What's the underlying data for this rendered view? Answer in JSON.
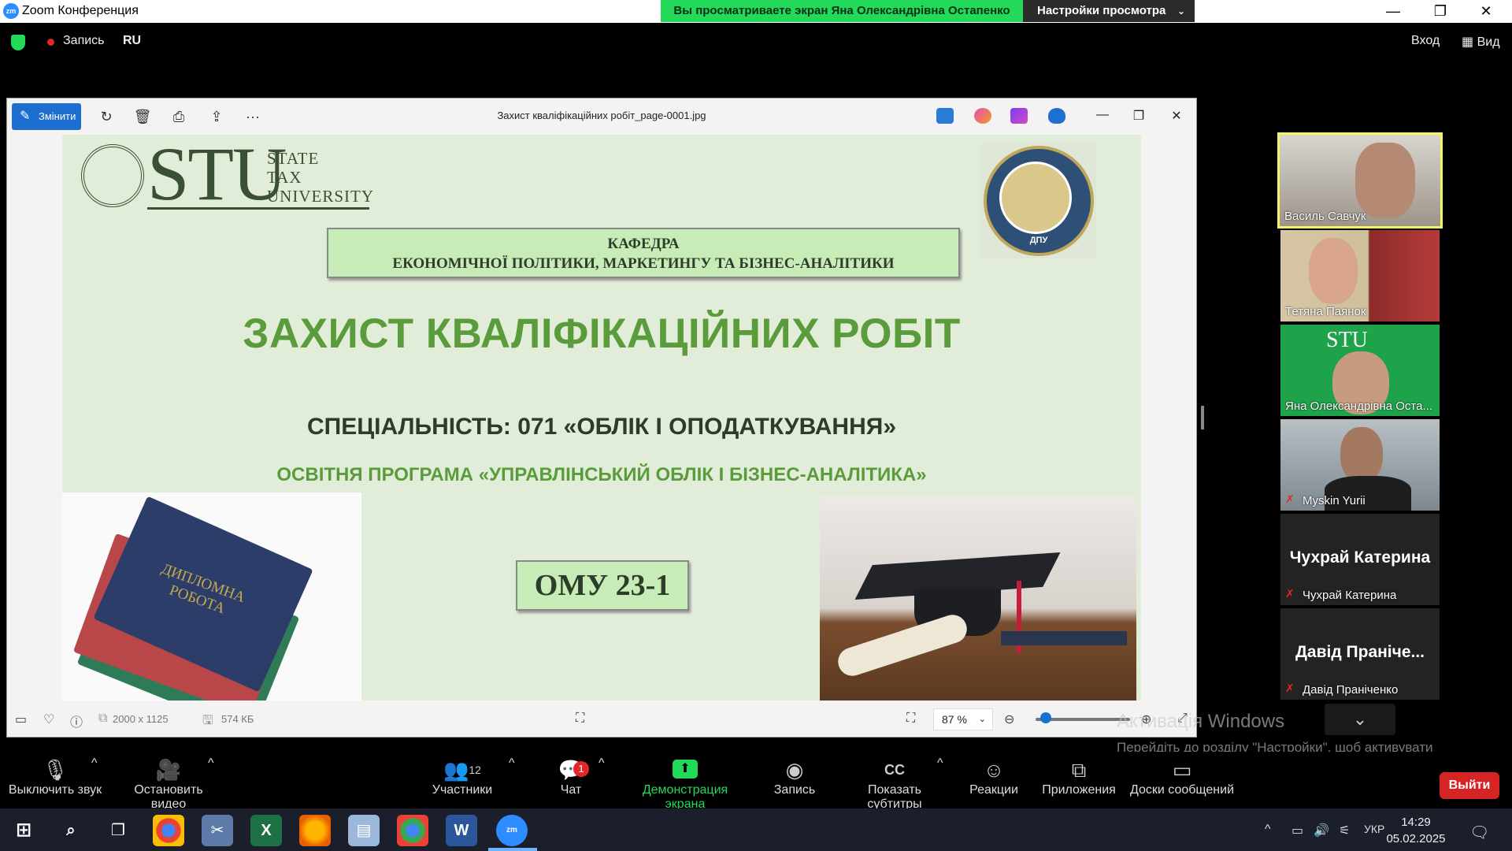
{
  "window": {
    "title": "Zoom Конференция",
    "app_icon_text": "zm",
    "share_banner": "Вы просматриваете экран Яна Олександрівна Остапенко",
    "view_settings": "Настройки просмотра",
    "minimize": "—",
    "restore": "❐",
    "close": "✕"
  },
  "meeting_top": {
    "record_label": "Запись",
    "language": "RU",
    "sign_in": "Вход",
    "view": "Вид"
  },
  "viewer": {
    "edit_label": "Змінити",
    "file_name": "Захист кваліфікаційних робіт_page-0001.jpg",
    "more": "···",
    "dimensions": "2000 x 1125",
    "file_size": "574 КБ",
    "zoom_level": "87 %"
  },
  "slide": {
    "logo_letters": "STU",
    "logo_line1": "STATE",
    "logo_line2": "TAX",
    "logo_line3": "UNIVERSITY",
    "seal_text": "ДПУ",
    "kafedra_line1": "КАФЕДРА",
    "kafedra_line2": "ЕКОНОМІЧНОЇ ПОЛІТИКИ, МАРКЕТИНГУ ТА БІЗНЕС-АНАЛІТИКИ",
    "main_title": "ЗАХИСТ КВАЛІФІКАЦІЙНИХ РОБІТ",
    "specialty": "СПЕЦІАЛЬНІСТЬ: 071 «ОБЛІК І ОПОДАТКУВАННЯ»",
    "program": "ОСВІТНЯ ПРОГРАМА «УПРАВЛІНСЬКИЙ ОБЛІК І БІЗНЕС-АНАЛІТИКА»",
    "book_label_line1": "ДИПЛОМНА",
    "book_label_line2": "РОБОТА",
    "group": "ОМУ 23-1"
  },
  "participants": [
    {
      "name": "Василь Савчук",
      "muted": false,
      "video": true
    },
    {
      "name": "Тетяна Паянок",
      "muted": false,
      "video": true
    },
    {
      "name": "Яна Олександрівна Оста...",
      "muted": false,
      "video": true
    },
    {
      "name": "Myskin Yurii",
      "muted": true,
      "video": true
    },
    {
      "name": "Чухрай Катерина",
      "big": "Чухрай Катерина",
      "muted": true,
      "video": false
    },
    {
      "name": "Давід Праніченко",
      "big": "Давід Праніче...",
      "muted": true,
      "video": false
    }
  ],
  "activation": {
    "title": "Активація Windows",
    "subtitle": "Перейдіть до розділу \"Настройки\", щоб активувати Windows."
  },
  "toolbar": {
    "mute": "Выключить звук",
    "stop_video": "Остановить видео",
    "participants": "Участники",
    "participants_count": "12",
    "chat": "Чат",
    "chat_badge": "1",
    "share": "Демонстрация экрана",
    "record": "Запись",
    "captions": "Показать субтитры",
    "reactions": "Реакции",
    "apps": "Приложения",
    "whiteboards": "Доски сообщений",
    "leave": "Выйти"
  },
  "taskbar": {
    "language": "УКР",
    "time": "14:29",
    "date": "05.02.2025"
  }
}
